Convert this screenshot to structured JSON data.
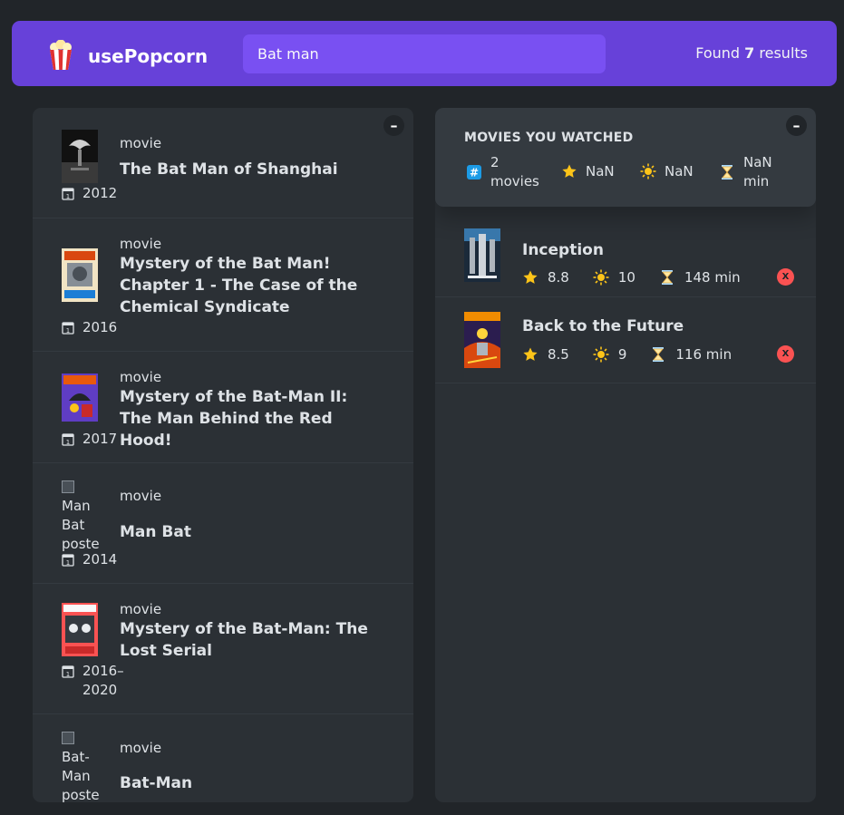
{
  "nav": {
    "logo_text": "usePopcorn",
    "search_value": "Bat man",
    "results_prefix": "Found",
    "results_count": "7",
    "results_suffix": "results",
    "accent_color": "#6741d9",
    "search_bg": "#7950f2"
  },
  "list_box": {
    "toggle_label": "–",
    "movies": [
      {
        "type": "movie",
        "title": "The Bat Man of Shanghai",
        "year": "2012",
        "poster": "poster-image"
      },
      {
        "type": "movie",
        "title": "Mystery of the Bat Man! Chapter 1 - The Case of the Chemical Syndicate",
        "year": "2016",
        "poster": "poster-image"
      },
      {
        "type": "movie",
        "title": "Mystery of the Bat-Man II: The Man Behind the Red Hood!",
        "year": "2017",
        "poster": "poster-image"
      },
      {
        "type": "movie",
        "title": "Man Bat",
        "year": "2014",
        "poster_alt": "Man Bat poste"
      },
      {
        "type": "movie",
        "title": "Mystery of the Bat-Man: The Lost Serial",
        "year": "2016–2020",
        "poster": "poster-image"
      },
      {
        "type": "movie",
        "title": "Bat-Man",
        "year": "",
        "poster_alt": "Bat-Man poste"
      }
    ]
  },
  "watched_box": {
    "toggle_label": "–",
    "summary": {
      "heading": "Movies you watched",
      "count": "2 movies",
      "imdb_avg": "NaN",
      "user_avg": "NaN",
      "runtime_avg": "NaN min",
      "icons": [
        "hash-icon",
        "star-icon",
        "sun-icon",
        "hourglass-icon"
      ]
    },
    "movies": [
      {
        "title": "Inception",
        "imdb": "8.8",
        "user": "10",
        "runtime": "148 min",
        "delete_label": "X"
      },
      {
        "title": "Back to the Future",
        "imdb": "8.5",
        "user": "9",
        "runtime": "116 min",
        "delete_label": "X"
      }
    ]
  }
}
